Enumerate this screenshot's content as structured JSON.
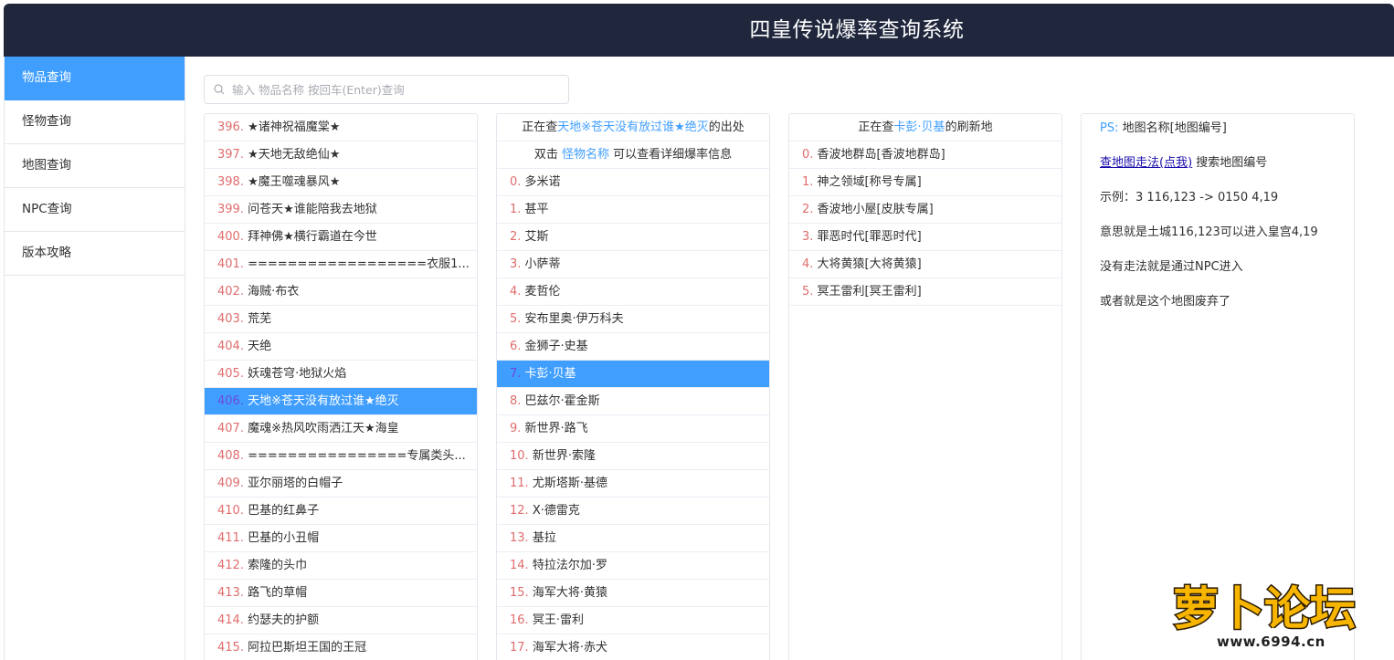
{
  "header": {
    "title": "四皇传说爆率查询系统"
  },
  "sidebar": {
    "items": [
      {
        "label": "物品查询",
        "active": true
      },
      {
        "label": "怪物查询",
        "active": false
      },
      {
        "label": "地图查询",
        "active": false
      },
      {
        "label": "NPC查询",
        "active": false
      },
      {
        "label": "版本攻略",
        "active": false
      }
    ]
  },
  "search": {
    "placeholder": "输入 物品名称 按回车(Enter)查询",
    "value": ""
  },
  "items_list": [
    {
      "num": "396.",
      "name": "★诸神祝福魔棠★"
    },
    {
      "num": "397.",
      "name": "★天地无敌绝仙★"
    },
    {
      "num": "398.",
      "name": "★魔王噬魂暴风★"
    },
    {
      "num": "399.",
      "name": "问苍天★谁能陪我去地狱"
    },
    {
      "num": "400.",
      "name": "拜神佛★横行霸道在今世"
    },
    {
      "num": "401.",
      "name": "==================衣服1..."
    },
    {
      "num": "402.",
      "name": "海贼·布衣"
    },
    {
      "num": "403.",
      "name": "荒芜"
    },
    {
      "num": "404.",
      "name": "天绝"
    },
    {
      "num": "405.",
      "name": "妖魂苍穹·地狱火焰"
    },
    {
      "num": "406.",
      "name": "天地※苍天没有放过谁★绝灭",
      "selected": true
    },
    {
      "num": "407.",
      "name": "魔魂※热风吹雨洒江天★海皇"
    },
    {
      "num": "408.",
      "name": "================专属类头..."
    },
    {
      "num": "409.",
      "name": "亚尔丽塔的白帽子"
    },
    {
      "num": "410.",
      "name": "巴基的红鼻子"
    },
    {
      "num": "411.",
      "name": "巴基的小丑帽"
    },
    {
      "num": "412.",
      "name": "索隆的头巾"
    },
    {
      "num": "413.",
      "name": "路飞的草帽"
    },
    {
      "num": "414.",
      "name": "约瑟夫的护额"
    },
    {
      "num": "415.",
      "name": "阿拉巴斯坦王国的王冠"
    }
  ],
  "monster_panel": {
    "header_prefix": "正在查",
    "header_item": "天地※苍天没有放过谁★绝灭",
    "header_suffix": "的出处",
    "hint_prefix": "双击 ",
    "hint_link": "怪物名称",
    "hint_suffix": " 可以查看详细爆率信息",
    "monsters": [
      {
        "num": "0.",
        "name": "多米诺"
      },
      {
        "num": "1.",
        "name": "甚平"
      },
      {
        "num": "2.",
        "name": "艾斯"
      },
      {
        "num": "3.",
        "name": "小萨蒂"
      },
      {
        "num": "4.",
        "name": "麦哲伦"
      },
      {
        "num": "5.",
        "name": "安布里奥·伊万科夫"
      },
      {
        "num": "6.",
        "name": "金狮子·史基"
      },
      {
        "num": "7.",
        "name": "卡彭·贝基",
        "selected": true
      },
      {
        "num": "8.",
        "name": "巴兹尔·霍金斯"
      },
      {
        "num": "9.",
        "name": "新世界·路飞"
      },
      {
        "num": "10.",
        "name": "新世界·索隆"
      },
      {
        "num": "11.",
        "name": "尤斯塔斯·基德"
      },
      {
        "num": "12.",
        "name": "X·德雷克"
      },
      {
        "num": "13.",
        "name": "基拉"
      },
      {
        "num": "14.",
        "name": "特拉法尔加·罗"
      },
      {
        "num": "15.",
        "name": "海军大将·黄猿"
      },
      {
        "num": "16.",
        "name": "冥王·雷利"
      },
      {
        "num": "17.",
        "name": "海军大将·赤犬"
      }
    ]
  },
  "map_panel": {
    "header_prefix": "正在查",
    "header_item": "卡彭·贝基",
    "header_suffix": "的刷新地",
    "maps": [
      {
        "num": "0.",
        "name": "香波地群岛[香波地群岛]"
      },
      {
        "num": "1.",
        "name": "神之领域[称号专属]"
      },
      {
        "num": "2.",
        "name": "香波地小屋[皮肤专属]"
      },
      {
        "num": "3.",
        "name": "罪恶时代[罪恶时代]"
      },
      {
        "num": "4.",
        "name": "大将黄猿[大将黄猿]"
      },
      {
        "num": "5.",
        "name": "冥王雷利[冥王雷利]"
      }
    ]
  },
  "info_panel": {
    "ps_label": "PS:",
    "ps_text": "地图名称[地图编号]",
    "link_text": "查地图走法(点我)",
    "link_suffix": "搜索地图编号",
    "example": "示例：3 116,123 -> 0150 4,19",
    "meaning": "意思就是土城116,123可以进入皇宫4,19",
    "no_route": "没有走法就是通过NPC进入",
    "abandoned": "或者就是这个地图废弃了"
  },
  "watermark": {
    "brand": "萝卜论坛",
    "domain": "www.6994.cn"
  },
  "colors": {
    "header_bg": "#20273d",
    "accent": "#409eff",
    "number": "#e06c6c"
  }
}
